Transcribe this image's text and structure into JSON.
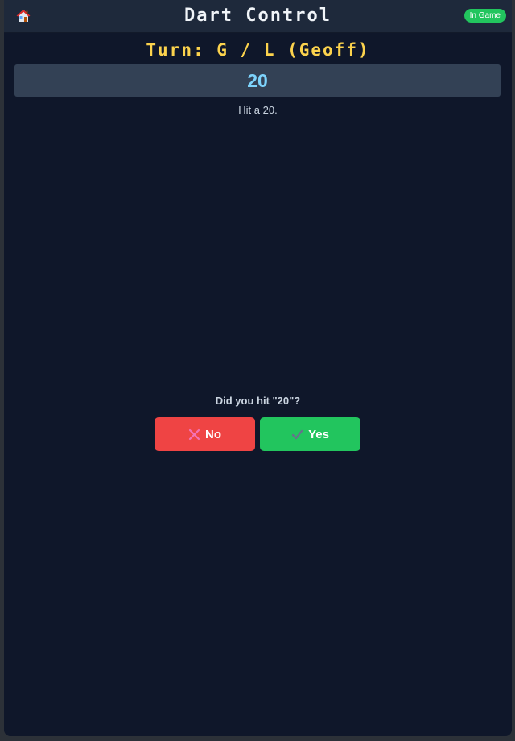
{
  "header": {
    "title": "Dart Control",
    "status_badge": "In Game",
    "home_icon": "house-icon"
  },
  "turn": {
    "text": "Turn: G / L (Geoff)"
  },
  "target": {
    "value": "20",
    "instruction": "Hit a 20."
  },
  "prompt": {
    "question": "Did you hit \"20\"?",
    "no_label": "No",
    "no_icon": "cross-icon",
    "yes_label": "Yes",
    "yes_icon": "check-icon"
  },
  "colors": {
    "background": "#0f172a",
    "header": "#1e293b",
    "turn_text": "#fcd34d",
    "target_box": "#334155",
    "target_text": "#7dd3fc",
    "no_button": "#ef4444",
    "yes_button": "#22c55e",
    "badge": "#22c55e"
  }
}
